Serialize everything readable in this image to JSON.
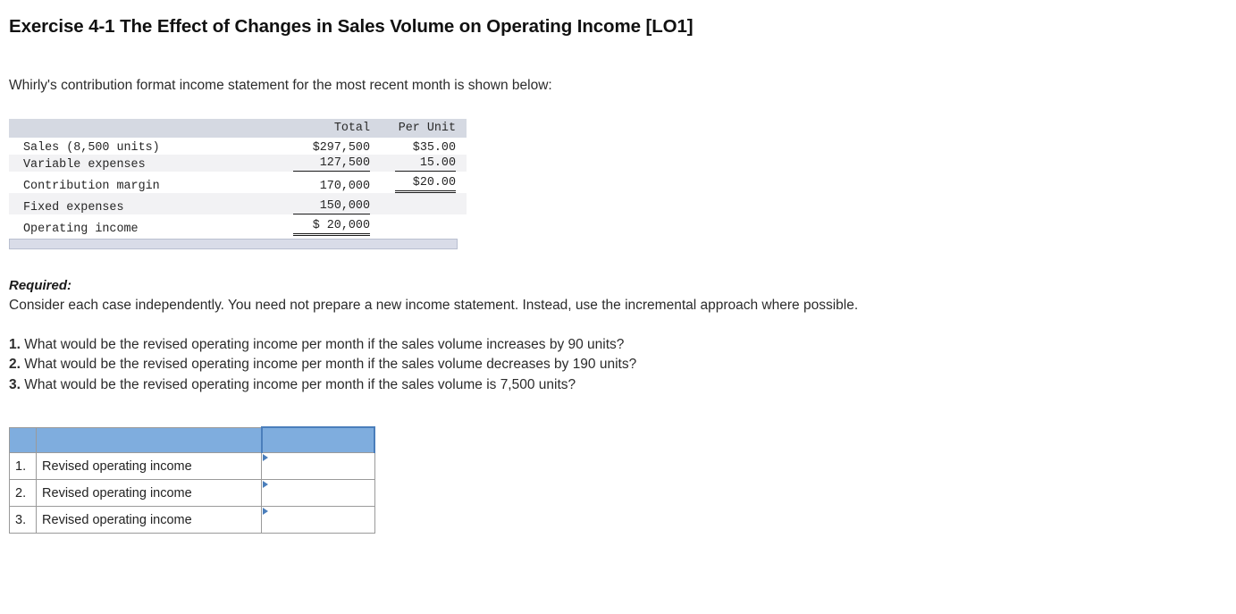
{
  "exercise": {
    "title": "Exercise 4-1 The Effect of Changes in Sales Volume on Operating Income [LO1]",
    "intro": "Whirly's contribution format income statement for the most recent month is shown below:"
  },
  "income_statement": {
    "headers": {
      "label": "",
      "total": "Total",
      "per_unit": "Per Unit"
    },
    "rows": [
      {
        "label": "Sales (8,500 units)",
        "total": "$297,500",
        "per_unit": "$35.00"
      },
      {
        "label": "Variable expenses",
        "total": "127,500",
        "per_unit": "15.00"
      },
      {
        "label": "Contribution margin",
        "total": "170,000",
        "per_unit": "$20.00"
      },
      {
        "label": "Fixed expenses",
        "total": "150,000",
        "per_unit": ""
      },
      {
        "label": "Operating income",
        "total": "$ 20,000",
        "per_unit": ""
      }
    ]
  },
  "required": {
    "label": "Required:",
    "body": "Consider each case independently. You need not prepare a new income statement. Instead, use the incremental approach where possible."
  },
  "questions": [
    {
      "num": "1.",
      "text": "What would be the revised operating income per month if the sales volume increases by 90 units?"
    },
    {
      "num": "2.",
      "text": "What would be the revised operating income per month if the sales volume decreases by 190 units?"
    },
    {
      "num": "3.",
      "text": "What would be the revised operating income per month if the sales volume is 7,500 units?"
    }
  ],
  "answer_table": {
    "header": {
      "num": "",
      "label": "",
      "input": ""
    },
    "rows": [
      {
        "num": "1.",
        "label": "Revised operating income",
        "value": "",
        "placeholder": ""
      },
      {
        "num": "2.",
        "label": "Revised operating income",
        "value": "",
        "placeholder": ""
      },
      {
        "num": "3.",
        "label": "Revised operating income",
        "value": "",
        "placeholder": ""
      }
    ]
  },
  "colors": {
    "header_blue": "#7fadde",
    "input_border_blue": "#4a7ebb",
    "statement_header_grey": "#d5d9e2",
    "statement_footer": "#d9dce8"
  }
}
